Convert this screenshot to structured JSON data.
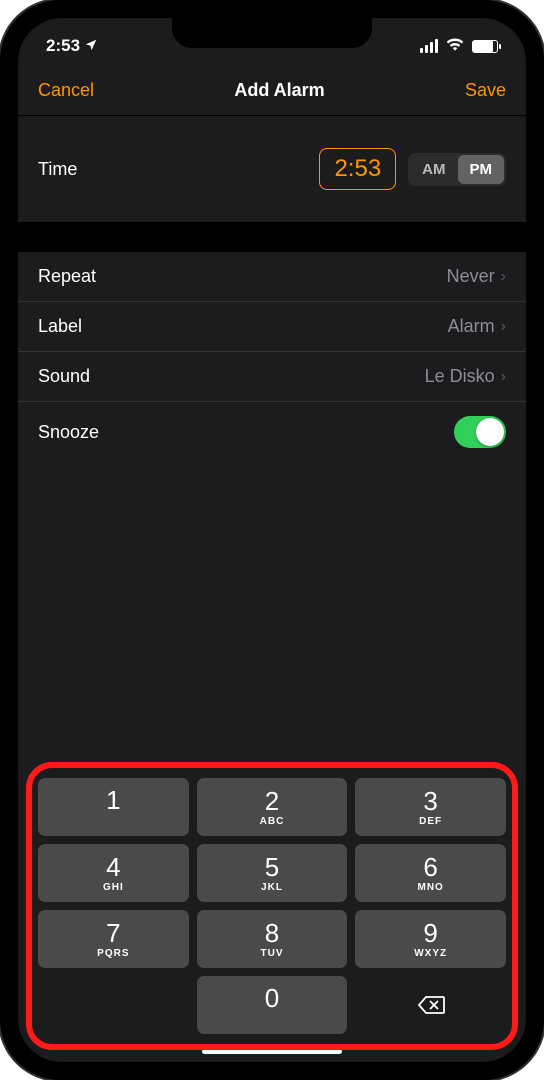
{
  "statusBar": {
    "time": "2:53",
    "locationActive": true
  },
  "nav": {
    "cancel": "Cancel",
    "title": "Add Alarm",
    "save": "Save"
  },
  "timeSection": {
    "label": "Time",
    "value": "2:53",
    "am": "AM",
    "pm": "PM",
    "selected": "PM"
  },
  "settings": {
    "repeat": {
      "label": "Repeat",
      "value": "Never"
    },
    "alarmLabel": {
      "label": "Label",
      "value": "Alarm"
    },
    "sound": {
      "label": "Sound",
      "value": "Le Disko"
    },
    "snooze": {
      "label": "Snooze",
      "on": true
    }
  },
  "keypad": [
    {
      "num": "1",
      "letters": ""
    },
    {
      "num": "2",
      "letters": "ABC"
    },
    {
      "num": "3",
      "letters": "DEF"
    },
    {
      "num": "4",
      "letters": "GHI"
    },
    {
      "num": "5",
      "letters": "JKL"
    },
    {
      "num": "6",
      "letters": "MNO"
    },
    {
      "num": "7",
      "letters": "PQRS"
    },
    {
      "num": "8",
      "letters": "TUV"
    },
    {
      "num": "9",
      "letters": "WXYZ"
    },
    {
      "blank": true
    },
    {
      "num": "0",
      "letters": ""
    },
    {
      "backspace": true
    }
  ]
}
